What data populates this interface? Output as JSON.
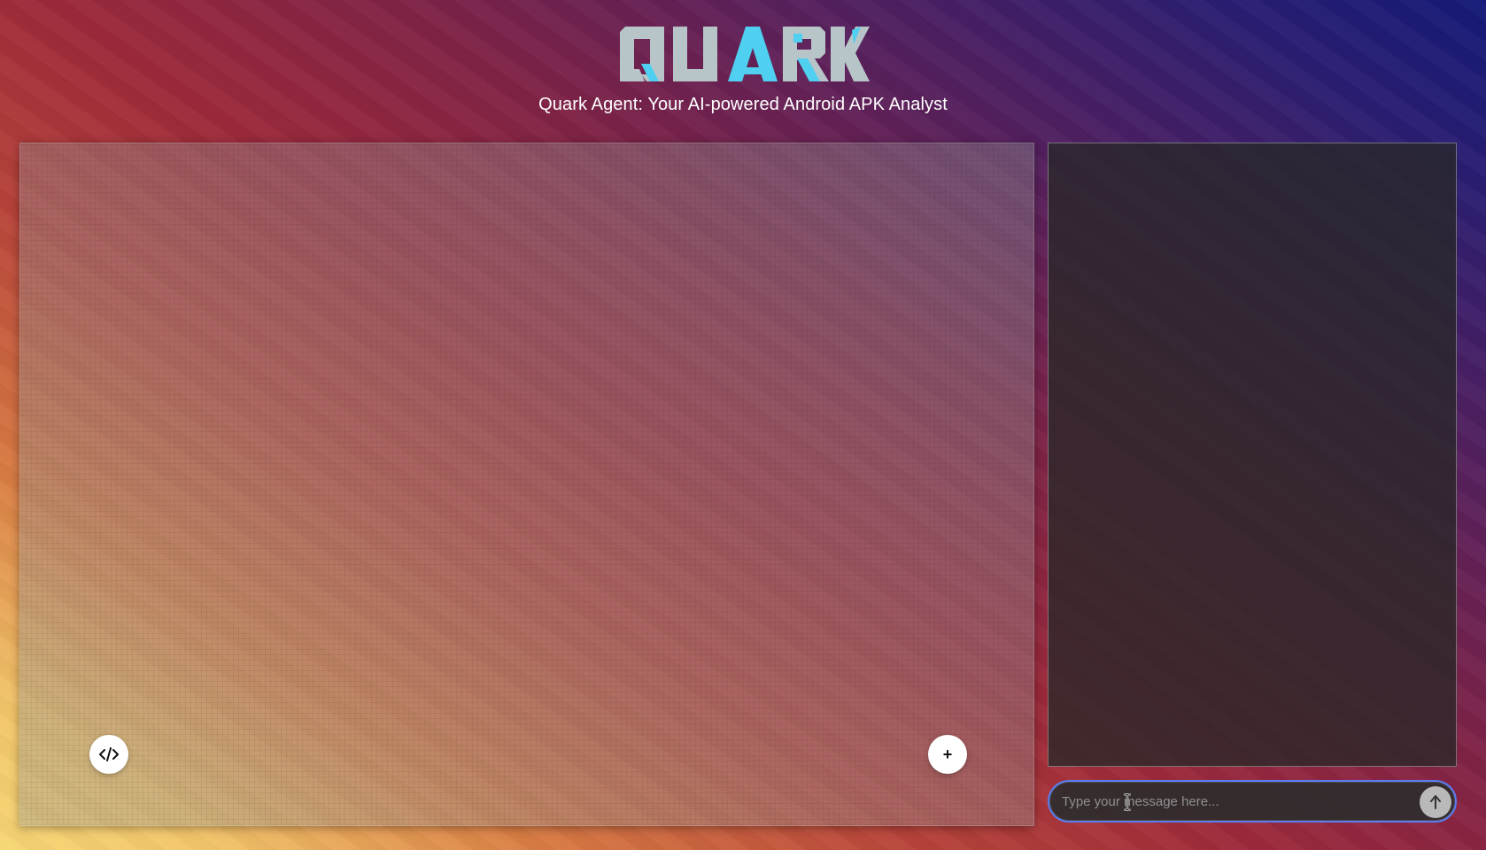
{
  "header": {
    "logo_text": "QUARK",
    "subtitle": "Quark Agent: Your AI-powered Android APK Analyst"
  },
  "canvas": {
    "code_button_icon": "code-icon",
    "add_button_label": "+"
  },
  "chat": {
    "input": {
      "placeholder": "Type your message here...",
      "value": ""
    },
    "send_button_icon": "arrow-up-icon"
  },
  "colors": {
    "logo_silver": "#b7c4c8",
    "logo_cyan": "#4fd0f0",
    "input_focus_border": "#5a7cf0"
  }
}
